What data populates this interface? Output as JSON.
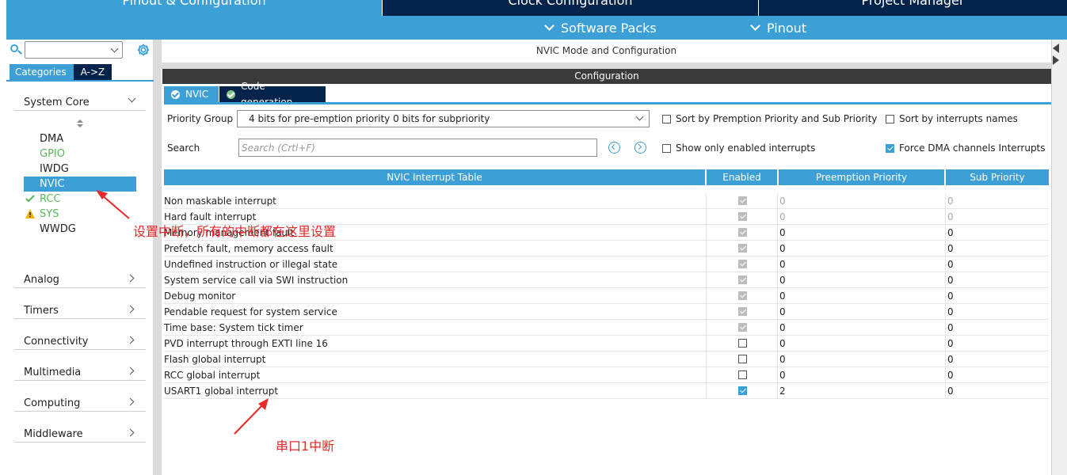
{
  "top_tabs": [
    "Pinout & Configuration",
    "Clock Configuration",
    "Project Manager"
  ],
  "sub_menu": [
    "Software Packs",
    "Pinout"
  ],
  "left_panel": {
    "tabs": [
      "Categories",
      "A->Z"
    ],
    "sections": [
      "System Core",
      "Analog",
      "Timers",
      "Connectivity",
      "Multimedia",
      "Computing",
      "Middleware"
    ],
    "core_items": [
      {
        "label": "DMA",
        "state": "normal"
      },
      {
        "label": "GPIO",
        "state": "green"
      },
      {
        "label": "IWDG",
        "state": "normal"
      },
      {
        "label": "NVIC",
        "state": "selected"
      },
      {
        "label": "RCC",
        "state": "ok"
      },
      {
        "label": "SYS",
        "state": "warning"
      },
      {
        "label": "WWDG",
        "state": "normal"
      }
    ]
  },
  "main": {
    "mode_title": "NVIC Mode and Configuration",
    "config_header": "Configuration",
    "tabs": [
      "NVIC",
      "Code generation"
    ],
    "priority_group_label": "Priority Group",
    "priority_group_value": "4 bits for pre-emption priority 0 bits for subpriority",
    "search_label": "Search",
    "search_placeholder": "Search (Crtl+F)",
    "options": [
      {
        "label": "Sort by Premption Priority and Sub Priority",
        "checked": false
      },
      {
        "label": "Sort by interrupts names",
        "checked": false
      },
      {
        "label": "Show only enabled interrupts",
        "checked": false
      },
      {
        "label": "Force DMA channels Interrupts",
        "checked": true
      }
    ]
  },
  "table": {
    "headers": [
      "NVIC Interrupt Table",
      "Enabled",
      "Preemption Priority",
      "Sub Priority"
    ],
    "rows": [
      {
        "name": "Non maskable interrupt",
        "enabled": "locked",
        "preemption": "0",
        "sub": "0",
        "muted": true
      },
      {
        "name": "Hard fault interrupt",
        "enabled": "locked",
        "preemption": "0",
        "sub": "0",
        "muted": true
      },
      {
        "name": "Memory management fault",
        "enabled": "locked",
        "preemption": "0",
        "sub": "0",
        "muted": false
      },
      {
        "name": "Prefetch fault, memory access fault",
        "enabled": "locked",
        "preemption": "0",
        "sub": "0",
        "muted": false
      },
      {
        "name": "Undefined instruction or illegal state",
        "enabled": "locked",
        "preemption": "0",
        "sub": "0",
        "muted": false
      },
      {
        "name": "System service call via SWI instruction",
        "enabled": "locked",
        "preemption": "0",
        "sub": "0",
        "muted": false
      },
      {
        "name": "Debug monitor",
        "enabled": "locked",
        "preemption": "0",
        "sub": "0",
        "muted": false
      },
      {
        "name": "Pendable request for system service",
        "enabled": "locked",
        "preemption": "0",
        "sub": "0",
        "muted": false
      },
      {
        "name": "Time base: System tick timer",
        "enabled": "locked",
        "preemption": "0",
        "sub": "0",
        "muted": false
      },
      {
        "name": "PVD interrupt through EXTI line 16",
        "enabled": "unchecked",
        "preemption": "0",
        "sub": "0",
        "muted": false
      },
      {
        "name": "Flash global interrupt",
        "enabled": "unchecked",
        "preemption": "0",
        "sub": "0",
        "muted": false
      },
      {
        "name": "RCC global interrupt",
        "enabled": "unchecked",
        "preemption": "0",
        "sub": "0",
        "muted": false
      },
      {
        "name": "USART1 global interrupt",
        "enabled": "checked",
        "preemption": "2",
        "sub": "0",
        "muted": false
      }
    ]
  },
  "annotations": [
    "设置中断，所有的中断都在这里设置",
    "串口1中断"
  ],
  "colors": {
    "accent": "#3ca0d7",
    "dark_tab": "#03234b",
    "annotation": "#e8282a",
    "ok_green": "#5cb85c",
    "warning": "#f0b400"
  }
}
